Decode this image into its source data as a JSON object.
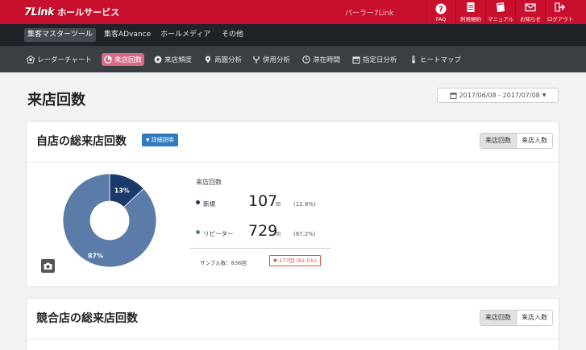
{
  "header": {
    "logo_badge": "7Link",
    "logo_text": "ホールサービス",
    "shop_name": "パーラー7Link",
    "icons": [
      {
        "label": "FAQ",
        "icon": "question-icon"
      },
      {
        "label": "利用規約",
        "icon": "document-icon"
      },
      {
        "label": "マニュアル",
        "icon": "book-icon"
      },
      {
        "label": "お知らせ",
        "icon": "mail-icon"
      },
      {
        "label": "ログアウト",
        "icon": "logout-icon"
      }
    ]
  },
  "nav_main": {
    "items": [
      "集客マスターツール",
      "集客ADvance",
      "ホールメディア",
      "その他"
    ],
    "active": "集客マスターツール"
  },
  "nav_sub": {
    "items": [
      {
        "label": "レーダーチャート",
        "icon": "radar-icon"
      },
      {
        "label": "来店回数",
        "icon": "pie-icon"
      },
      {
        "label": "来店頻度",
        "icon": "frequency-icon"
      },
      {
        "label": "商圏分析",
        "icon": "map-pin-icon"
      },
      {
        "label": "併用分析",
        "icon": "fork-icon"
      },
      {
        "label": "滞在時間",
        "icon": "clock-icon"
      },
      {
        "label": "指定日分析",
        "icon": "calendar-icon"
      },
      {
        "label": "ヒートマップ",
        "icon": "thermometer-icon"
      }
    ],
    "active": "来店回数"
  },
  "page": {
    "title": "来店回数",
    "date_range": "2017/06/08 - 2017/07/08"
  },
  "panel_own": {
    "title": "自店の総来店回数",
    "detail_button": "詳細説明",
    "toggle": [
      "来店回数",
      "来店人数"
    ],
    "toggle_active": "来店回数",
    "stats_heading": "来店回数",
    "new_label": "新規",
    "new_count": "107",
    "new_unit": "回",
    "new_pct": "(12.8%)",
    "repeat_label": "リピーター",
    "repeat_count": "729",
    "repeat_unit": "回",
    "repeat_pct": "(87.2%)",
    "sample": "サンプル数：836回",
    "change": "▼-177回 (82.5%)"
  },
  "panel_competitor": {
    "title": "競合店の総来店回数",
    "toggle": [
      "来店回数",
      "来店人数"
    ],
    "toggle_active": "来店回数"
  },
  "chart_data": {
    "type": "pie",
    "categories": [
      "新規",
      "リピーター"
    ],
    "values": [
      13,
      87
    ],
    "labels": [
      "13%",
      "87%"
    ],
    "colors": [
      "#1b3a6b",
      "#5b7ba8"
    ]
  },
  "colors": {
    "header_red": "#c8102e",
    "accent_pink": "#d86a84",
    "new_color": "#1b3a6b",
    "repeat_color": "#5b7ba8",
    "alert_red": "#d9534f"
  }
}
